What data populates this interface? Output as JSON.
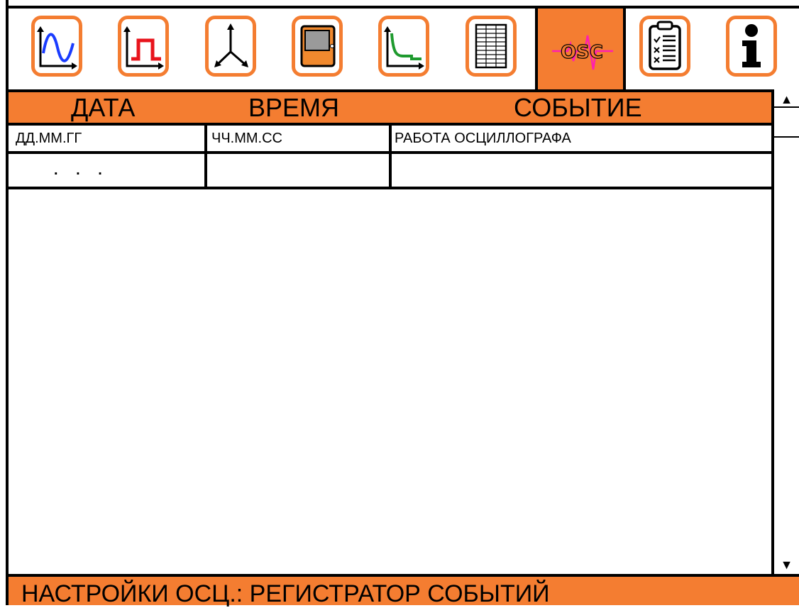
{
  "toolbar": {
    "tabs": [
      {
        "icon": "sine-wave-icon"
      },
      {
        "icon": "pulse-icon"
      },
      {
        "icon": "three-phase-vector-icon"
      },
      {
        "icon": "cabinet-icon"
      },
      {
        "icon": "decay-curve-icon"
      },
      {
        "icon": "table-icon"
      },
      {
        "icon": "osc-icon",
        "label": "OSC",
        "active": true
      },
      {
        "icon": "checklist-icon"
      },
      {
        "icon": "info-icon"
      }
    ],
    "accent": "#f47d31",
    "wave_color": "#ff1fb0"
  },
  "table": {
    "headers": [
      "ДАТА",
      "ВРЕМЯ",
      "СОБЫТИЕ"
    ],
    "rows": [
      [
        "ДД.ММ.ГГ",
        "ЧЧ.ММ.СС",
        "РАБОТА ОСЦИЛЛОГРАФА"
      ],
      [
        ". . .",
        "",
        ""
      ]
    ]
  },
  "scrollbar": {
    "up": "▲",
    "down": "▼"
  },
  "footer": {
    "status": "НАСТРОЙКИ ОСЦ.: РЕГИСТРАТОР СОБЫТИЙ"
  }
}
